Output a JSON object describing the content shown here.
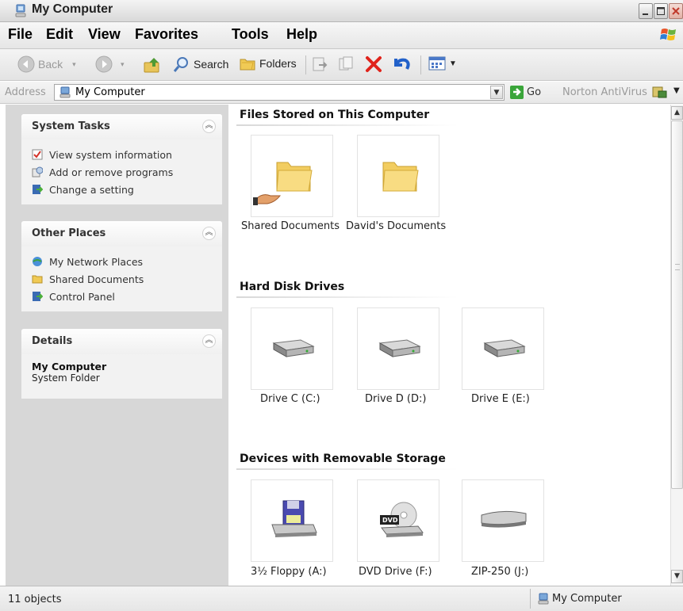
{
  "window": {
    "title": "My Computer"
  },
  "menu": [
    "File",
    "Edit",
    "View",
    "Favorites",
    "Tools",
    "Help"
  ],
  "toolbar": {
    "back_label": "Back",
    "search_label": "Search",
    "folders_label": "Folders"
  },
  "address": {
    "label": "Address",
    "value": "My Computer",
    "go_label": "Go",
    "norton_label": "Norton AntiVirus"
  },
  "sidebar": {
    "system_tasks": {
      "title": "System Tasks",
      "items": [
        {
          "label": "View system information",
          "icon": "system-info-icon"
        },
        {
          "label": "Add or remove programs",
          "icon": "add-remove-icon"
        },
        {
          "label": "Change a setting",
          "icon": "control-panel-icon"
        }
      ]
    },
    "other_places": {
      "title": "Other Places",
      "items": [
        {
          "label": "My Network Places",
          "icon": "network-places-icon"
        },
        {
          "label": "Shared Documents",
          "icon": "folder-icon"
        },
        {
          "label": "Control Panel",
          "icon": "control-panel-icon"
        }
      ]
    },
    "details": {
      "title": "Details",
      "name": "My Computer",
      "type": "System Folder"
    }
  },
  "groups": [
    {
      "title": "Files Stored on This Computer",
      "items": [
        {
          "label": "Shared Documents",
          "icon": "shared-folder-icon"
        },
        {
          "label": "David's Documents",
          "icon": "folder-icon"
        }
      ]
    },
    {
      "title": "Hard Disk Drives",
      "items": [
        {
          "label": "Drive C (C:)",
          "icon": "hard-drive-icon"
        },
        {
          "label": "Drive D (D:)",
          "icon": "hard-drive-icon"
        },
        {
          "label": "Drive E (E:)",
          "icon": "hard-drive-icon"
        }
      ]
    },
    {
      "title": "Devices with Removable Storage",
      "items": [
        {
          "label": "3½ Floppy (A:)",
          "icon": "floppy-drive-icon"
        },
        {
          "label": "DVD Drive (F:)",
          "icon": "dvd-drive-icon"
        },
        {
          "label": "ZIP-250 (J:)",
          "icon": "zip-drive-icon"
        }
      ]
    }
  ],
  "status": {
    "object_count": "11 objects",
    "zone": "My Computer"
  }
}
